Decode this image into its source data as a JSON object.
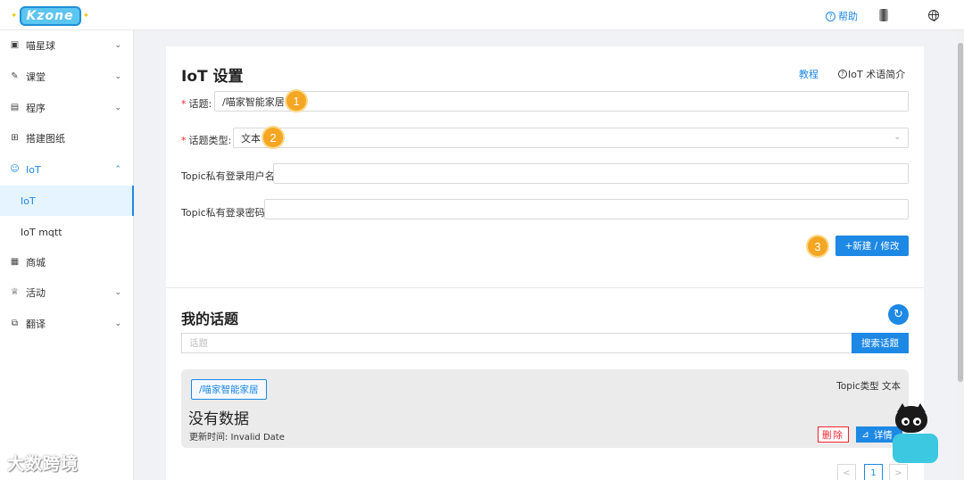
{
  "header": {
    "logo_text": "Kzone",
    "help_label": "帮助"
  },
  "sidebar": {
    "items": [
      {
        "label": "喵星球",
        "icon": "calendar-icon",
        "arrow": "down"
      },
      {
        "label": "课堂",
        "icon": "pen-icon",
        "arrow": "down"
      },
      {
        "label": "程序",
        "icon": "save-icon",
        "arrow": "down"
      },
      {
        "label": "搭建图纸",
        "icon": "blocks-icon",
        "arrow": ""
      },
      {
        "label": "IoT",
        "icon": "smile-icon",
        "arrow": "up"
      },
      {
        "label": "IoT",
        "icon": "",
        "arrow": ""
      },
      {
        "label": "IoT mqtt",
        "icon": "",
        "arrow": ""
      },
      {
        "label": "商城",
        "icon": "shop-icon",
        "arrow": ""
      },
      {
        "label": "活动",
        "icon": "trophy-icon",
        "arrow": "down"
      },
      {
        "label": "翻译",
        "icon": "translate-icon",
        "arrow": "down"
      }
    ],
    "watermark": "大数跨境"
  },
  "iot_settings": {
    "title": "IoT 设置",
    "tutorial_link": "教程",
    "glossary_link": "IoT 术语简介",
    "topic_label": "话题:",
    "topic_value": "/喵家智能家居",
    "topic_type_label": "话题类型:",
    "topic_type_value": "文本",
    "username_label": "Topic私有登录用户名:",
    "username_value": "",
    "password_label": "Topic私有登录密码:",
    "password_value": "",
    "submit_label": "+新建 / 修改",
    "markers": [
      "1",
      "2",
      "3"
    ]
  },
  "my_topics": {
    "title": "我的话题",
    "search_placeholder": "话题",
    "search_button": "搜索话题",
    "topic": {
      "tag": "/喵家智能家居",
      "type_text": "Topic类型 文本",
      "no_data": "没有数据",
      "update_time": "更新时间: Invalid Date",
      "delete_label": "删除",
      "detail_label": "详情"
    },
    "pagination": {
      "prev": "<",
      "current": "1",
      "next": ">"
    }
  },
  "colors": {
    "primary": "#1e88e5",
    "danger": "#f5222d",
    "marker": "#f5a623"
  }
}
